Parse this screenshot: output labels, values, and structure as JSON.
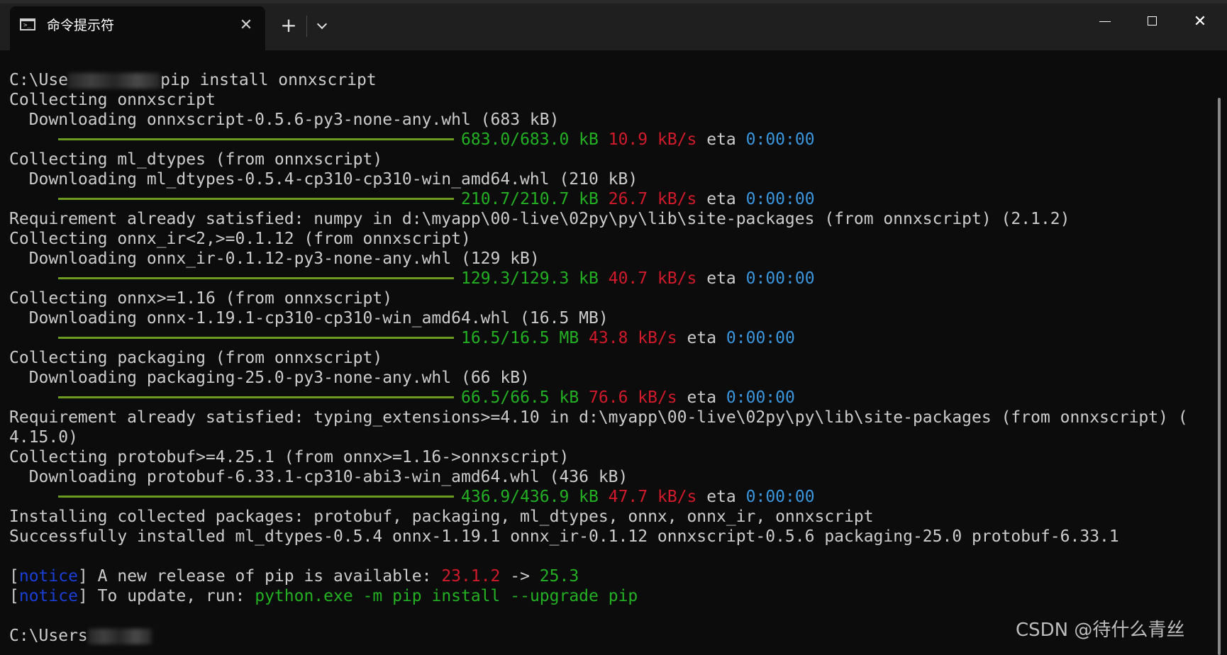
{
  "titlebar": {
    "tab_title": "命令提示符",
    "tab_close": "✕",
    "new_tab": "+",
    "minimize": "",
    "close": "✕"
  },
  "terminal": {
    "lines": [
      {
        "type": "cmd",
        "prefix": "C:\\Use",
        "suffix": "pip install onnxscript"
      },
      {
        "type": "text",
        "text": "Collecting onnxscript"
      },
      {
        "type": "text",
        "text": "  Downloading onnxscript-0.5.6-py3-none-any.whl (683 kB)"
      },
      {
        "type": "progress",
        "size": "683.0/683.0 kB",
        "speed": "10.9 kB/s",
        "eta_label": "eta",
        "eta": "0:00:00"
      },
      {
        "type": "text",
        "text": "Collecting ml_dtypes (from onnxscript)"
      },
      {
        "type": "text",
        "text": "  Downloading ml_dtypes-0.5.4-cp310-cp310-win_amd64.whl (210 kB)"
      },
      {
        "type": "progress",
        "size": "210.7/210.7 kB",
        "speed": "26.7 kB/s",
        "eta_label": "eta",
        "eta": "0:00:00"
      },
      {
        "type": "text",
        "text": "Requirement already satisfied: numpy in d:\\myapp\\00-live\\02py\\py\\lib\\site-packages (from onnxscript) (2.1.2)"
      },
      {
        "type": "text",
        "text": "Collecting onnx_ir<2,>=0.1.12 (from onnxscript)"
      },
      {
        "type": "text",
        "text": "  Downloading onnx_ir-0.1.12-py3-none-any.whl (129 kB)"
      },
      {
        "type": "progress",
        "size": "129.3/129.3 kB",
        "speed": "40.7 kB/s",
        "eta_label": "eta",
        "eta": "0:00:00"
      },
      {
        "type": "text",
        "text": "Collecting onnx>=1.16 (from onnxscript)"
      },
      {
        "type": "text",
        "text": "  Downloading onnx-1.19.1-cp310-cp310-win_amd64.whl (16.5 MB)"
      },
      {
        "type": "progress",
        "size": "16.5/16.5 MB",
        "speed": "43.8 kB/s",
        "eta_label": "eta",
        "eta": "0:00:00"
      },
      {
        "type": "text",
        "text": "Collecting packaging (from onnxscript)"
      },
      {
        "type": "text",
        "text": "  Downloading packaging-25.0-py3-none-any.whl (66 kB)"
      },
      {
        "type": "progress",
        "size": "66.5/66.5 kB",
        "speed": "76.6 kB/s",
        "eta_label": "eta",
        "eta": "0:00:00"
      },
      {
        "type": "text",
        "text": "Requirement already satisfied: typing_extensions>=4.10 in d:\\myapp\\00-live\\02py\\py\\lib\\site-packages (from onnxscript) ("
      },
      {
        "type": "text",
        "text": "4.15.0)"
      },
      {
        "type": "text",
        "text": "Collecting protobuf>=4.25.1 (from onnx>=1.16->onnxscript)"
      },
      {
        "type": "text",
        "text": "  Downloading protobuf-6.33.1-cp310-abi3-win_amd64.whl (436 kB)"
      },
      {
        "type": "progress",
        "size": "436.9/436.9 kB",
        "speed": "47.7 kB/s",
        "eta_label": "eta",
        "eta": "0:00:00"
      },
      {
        "type": "text",
        "text": "Installing collected packages: protobuf, packaging, ml_dtypes, onnx, onnx_ir, onnxscript"
      },
      {
        "type": "text",
        "text": "Successfully installed ml_dtypes-0.5.4 onnx-1.19.1 onnx_ir-0.1.12 onnxscript-0.5.6 packaging-25.0 protobuf-6.33.1"
      },
      {
        "type": "blank"
      },
      {
        "type": "notice",
        "open": "[",
        "tag": "notice",
        "close": "]",
        "msg": " A new release of pip is available: ",
        "old": "23.1.2",
        "arrow": " -> ",
        "new": "25.3"
      },
      {
        "type": "notice2",
        "open": "[",
        "tag": "notice",
        "close": "]",
        "msg": " To update, run: ",
        "cmd": "python.exe -m pip install --upgrade pip"
      },
      {
        "type": "blank"
      },
      {
        "type": "prompt",
        "prefix": "C:\\Users"
      }
    ]
  },
  "watermark": "CSDN @待什么青丝",
  "colors": {
    "background": "#0c0c0c",
    "titlebar": "#1f1f1f",
    "progress_bar": "#6b9b20",
    "green": "#23b023",
    "red": "#d11a2a",
    "blue": "#3a96dd",
    "notice": "#1a3fd6"
  },
  "icons": {
    "tab_icon": "terminal-icon",
    "tab_close": "close-icon",
    "new_tab": "plus-icon",
    "dropdown": "chevron-down-icon",
    "minimize": "minimize-icon",
    "maximize": "maximize-icon",
    "close": "close-icon"
  }
}
